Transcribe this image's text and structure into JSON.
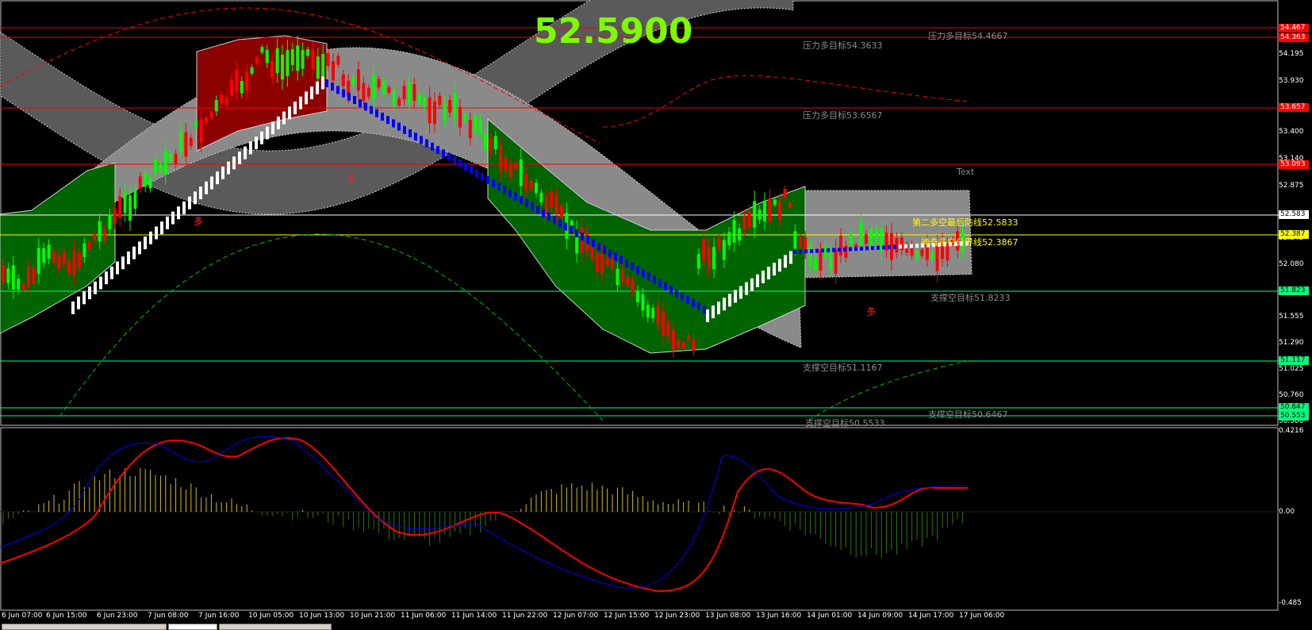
{
  "price_display": "52.5900",
  "level_labels": {
    "r1": "压力多目标54.4667",
    "r2": "压力多目标54.3633",
    "r3": "压力多目标53.6567",
    "second_defense": "第二多空最后防线52.5833",
    "divider": "神奇多空分界线52.3867",
    "s1": "支撑空目标51.8233",
    "s2": "支撑空目标51.1167",
    "s3": "支撑空目标50.6467",
    "s4": "支撑空目标50.5533",
    "text_obj": "Text"
  },
  "price_axis": [
    "54.195",
    "53.930",
    "53.400",
    "53.140",
    "52.875",
    "52.345",
    "52.080",
    "51.555",
    "51.290",
    "51.025",
    "50.760",
    "50.500"
  ],
  "price_tags": {
    "t54467": "54.467",
    "t54363": "54.363",
    "t53657": "53.657",
    "t53093": "53.093",
    "t52583": "52.583",
    "t52387": "52.387",
    "t51823": "51.823",
    "t51117": "51.117",
    "t50647": "50.647",
    "t50553": "50.553"
  },
  "osc_axis": [
    "0.4216",
    "0.00",
    "-0.485"
  ],
  "time_axis": [
    "6 Jun 07:00",
    "6 Jun 15:00",
    "6 Jun 23:00",
    "7 Jun 08:00",
    "7 Jun 16:00",
    "10 Jun 05:00",
    "10 Jun 13:00",
    "10 Jun 21:00",
    "11 Jun 06:00",
    "11 Jun 14:00",
    "11 Jun 22:00",
    "12 Jun 07:00",
    "12 Jun 15:00",
    "12 Jun 23:00",
    "13 Jun 08:00",
    "13 Jun 16:00",
    "14 Jun 01:00",
    "14 Jun 09:00",
    "14 Jun 17:00",
    "17 Jun 06:00"
  ],
  "signal_marks": [
    "多",
    "多",
    "多"
  ],
  "colors": {
    "bull_candle": "#00ff00",
    "bear_candle": "#ff0000",
    "resistance_line": "#ff0000",
    "support_line": "#00ff7f",
    "price_text": "#7cfc00",
    "macd_signal": "#ff0000",
    "macd_main": "#0000ff"
  }
}
